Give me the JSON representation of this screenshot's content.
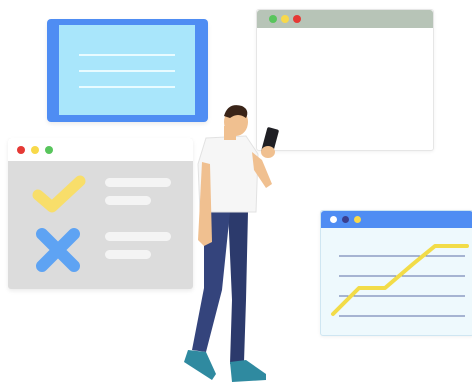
{
  "colors": {
    "blue_card_outer": "#4f8df3",
    "blue_card_inner": "#a9e6fb",
    "blue_card_lines": "#e8fbff",
    "browser_bar_gray": "#b7c4b7",
    "checklist_bg": "#dcdcdc",
    "checklist_bar": "#f4f4f4",
    "check_yellow": "#f8de6a",
    "cross_blue": "#5ea3f3",
    "chart_bar": "#4f8df3",
    "chart_bg": "#eef9fd",
    "chart_line": "#f2dc48",
    "dot_red": "#e53935",
    "dot_yellow": "#f8d94a",
    "dot_green": "#58c55c",
    "dot_navy": "#3a3f8f",
    "pants": "#2c3a6c",
    "shoes": "#2f8aa0",
    "shirt": "#f6f6f6",
    "skin": "#f0c090",
    "hair": "#3a2418"
  },
  "icons": [
    "check-icon",
    "cross-icon",
    "line-chart-icon",
    "phone-icon",
    "text-lines-icon"
  ]
}
